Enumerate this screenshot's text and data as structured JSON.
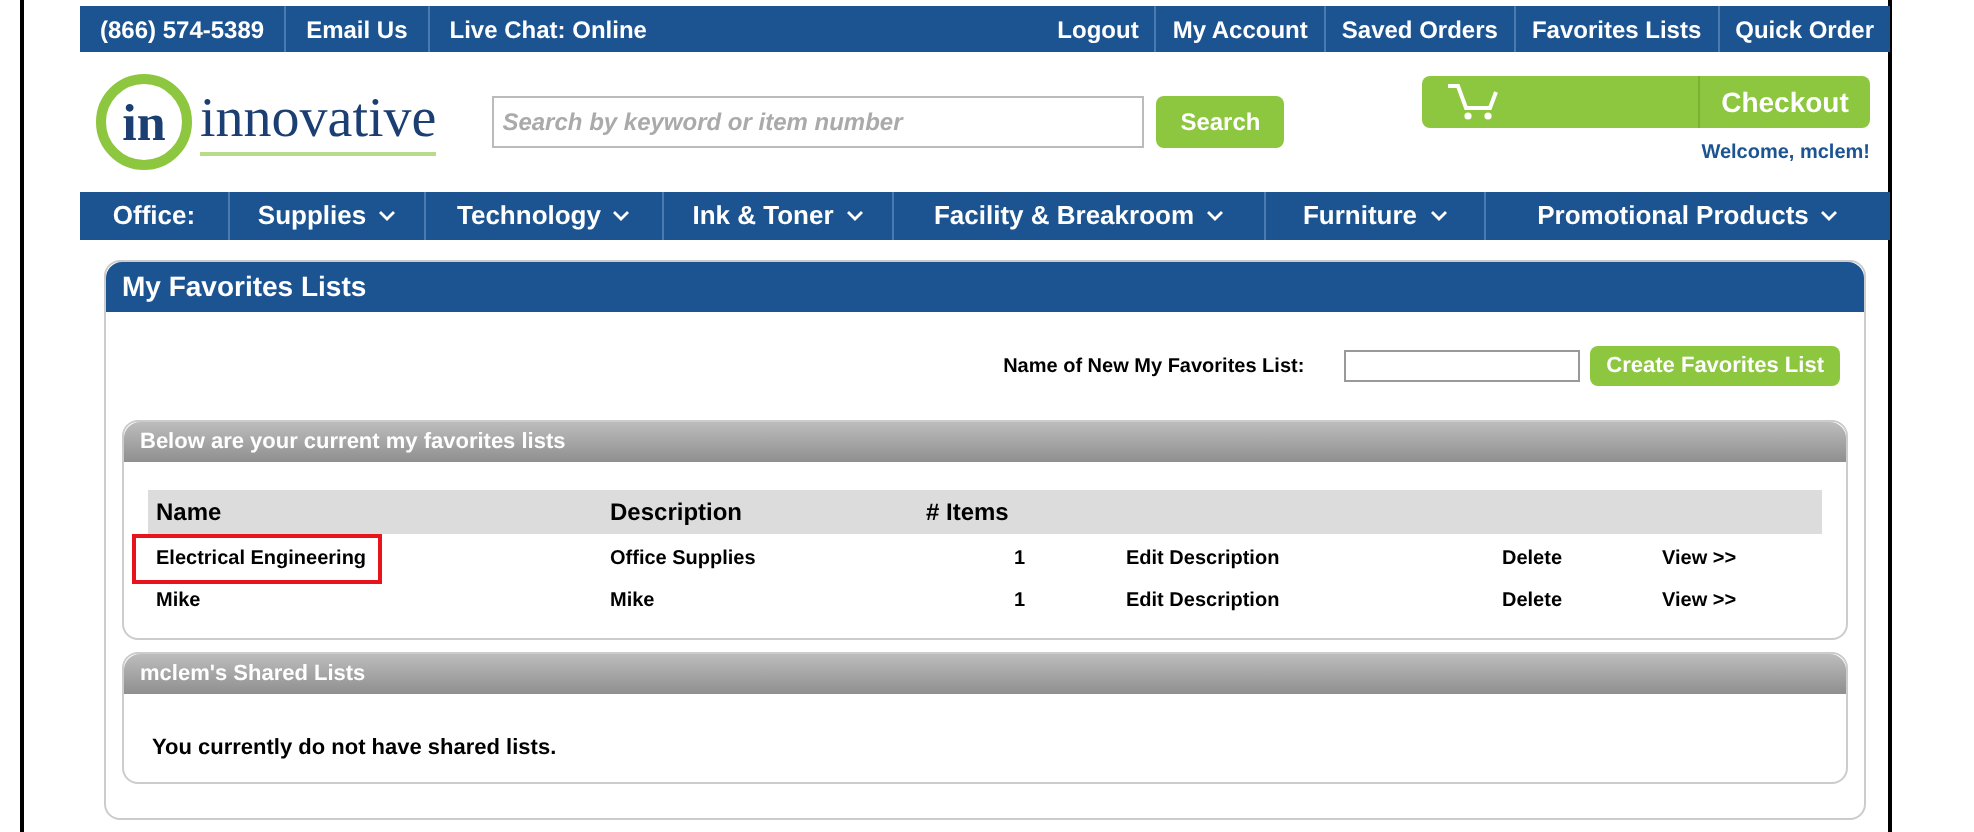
{
  "top_bar": {
    "left": [
      "(866) 574-5389",
      "Email Us",
      "Live Chat: Online"
    ],
    "right": [
      "Logout",
      "My Account",
      "Saved Orders",
      "Favorites Lists",
      "Quick Order"
    ]
  },
  "logo": {
    "mark": "in",
    "name": "innovative"
  },
  "search": {
    "placeholder": "Search by keyword or item number",
    "button": "Search"
  },
  "cart": {
    "button": "Checkout"
  },
  "welcome": "Welcome, mclem!",
  "nav": {
    "label": "Office:",
    "items": [
      "Supplies",
      "Technology",
      "Ink & Toner",
      "Facility & Breakroom",
      "Furniture",
      "Promotional Products"
    ]
  },
  "panel": {
    "title": "My Favorites Lists",
    "new_list_label": "Name of New My Favorites List:",
    "create_button": "Create Favorites List",
    "lists_section": {
      "title": "Below are your current my favorites lists",
      "columns": [
        "Name",
        "Description",
        "# Items"
      ],
      "rows": [
        {
          "name": "Electrical Engineering",
          "description": "Office Supplies",
          "items": "1",
          "actions": [
            "Edit Description",
            "Delete",
            "View >>"
          ],
          "highlighted": true
        },
        {
          "name": "Mike",
          "description": "Mike",
          "items": "1",
          "actions": [
            "Edit Description",
            "Delete",
            "View >>"
          ],
          "highlighted": false
        }
      ]
    },
    "shared_section": {
      "title": "mclem's Shared Lists",
      "message": "You currently do not have shared lists."
    }
  }
}
